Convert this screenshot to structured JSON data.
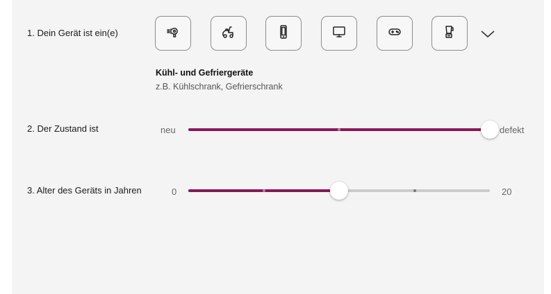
{
  "question1": {
    "label": "1. Dein Gerät ist ein(e)",
    "devices": [
      {
        "icon": "hair-dryer-icon"
      },
      {
        "icon": "lawn-tractor-icon"
      },
      {
        "icon": "smartphone-icon"
      },
      {
        "icon": "monitor-icon"
      },
      {
        "icon": "gamepad-icon"
      },
      {
        "icon": "blender-icon"
      }
    ],
    "selected_title": "Kühl- und Gefriergeräte",
    "selected_subtitle": "z.B. Kühlschrank, Gefrierschrank"
  },
  "question2": {
    "label": "2. Der Zustand ist",
    "min_label": "neu",
    "max_label": "defekt",
    "value_fraction": 1.0
  },
  "question3": {
    "label": "3. Alter des Geräts in Jahren",
    "min_label": "0",
    "max_label": "20",
    "min": 0,
    "max": 20,
    "value": 10
  },
  "colors": {
    "accent": "#8a1657",
    "track": "#cccccc",
    "panel": "#f4f4f4"
  }
}
